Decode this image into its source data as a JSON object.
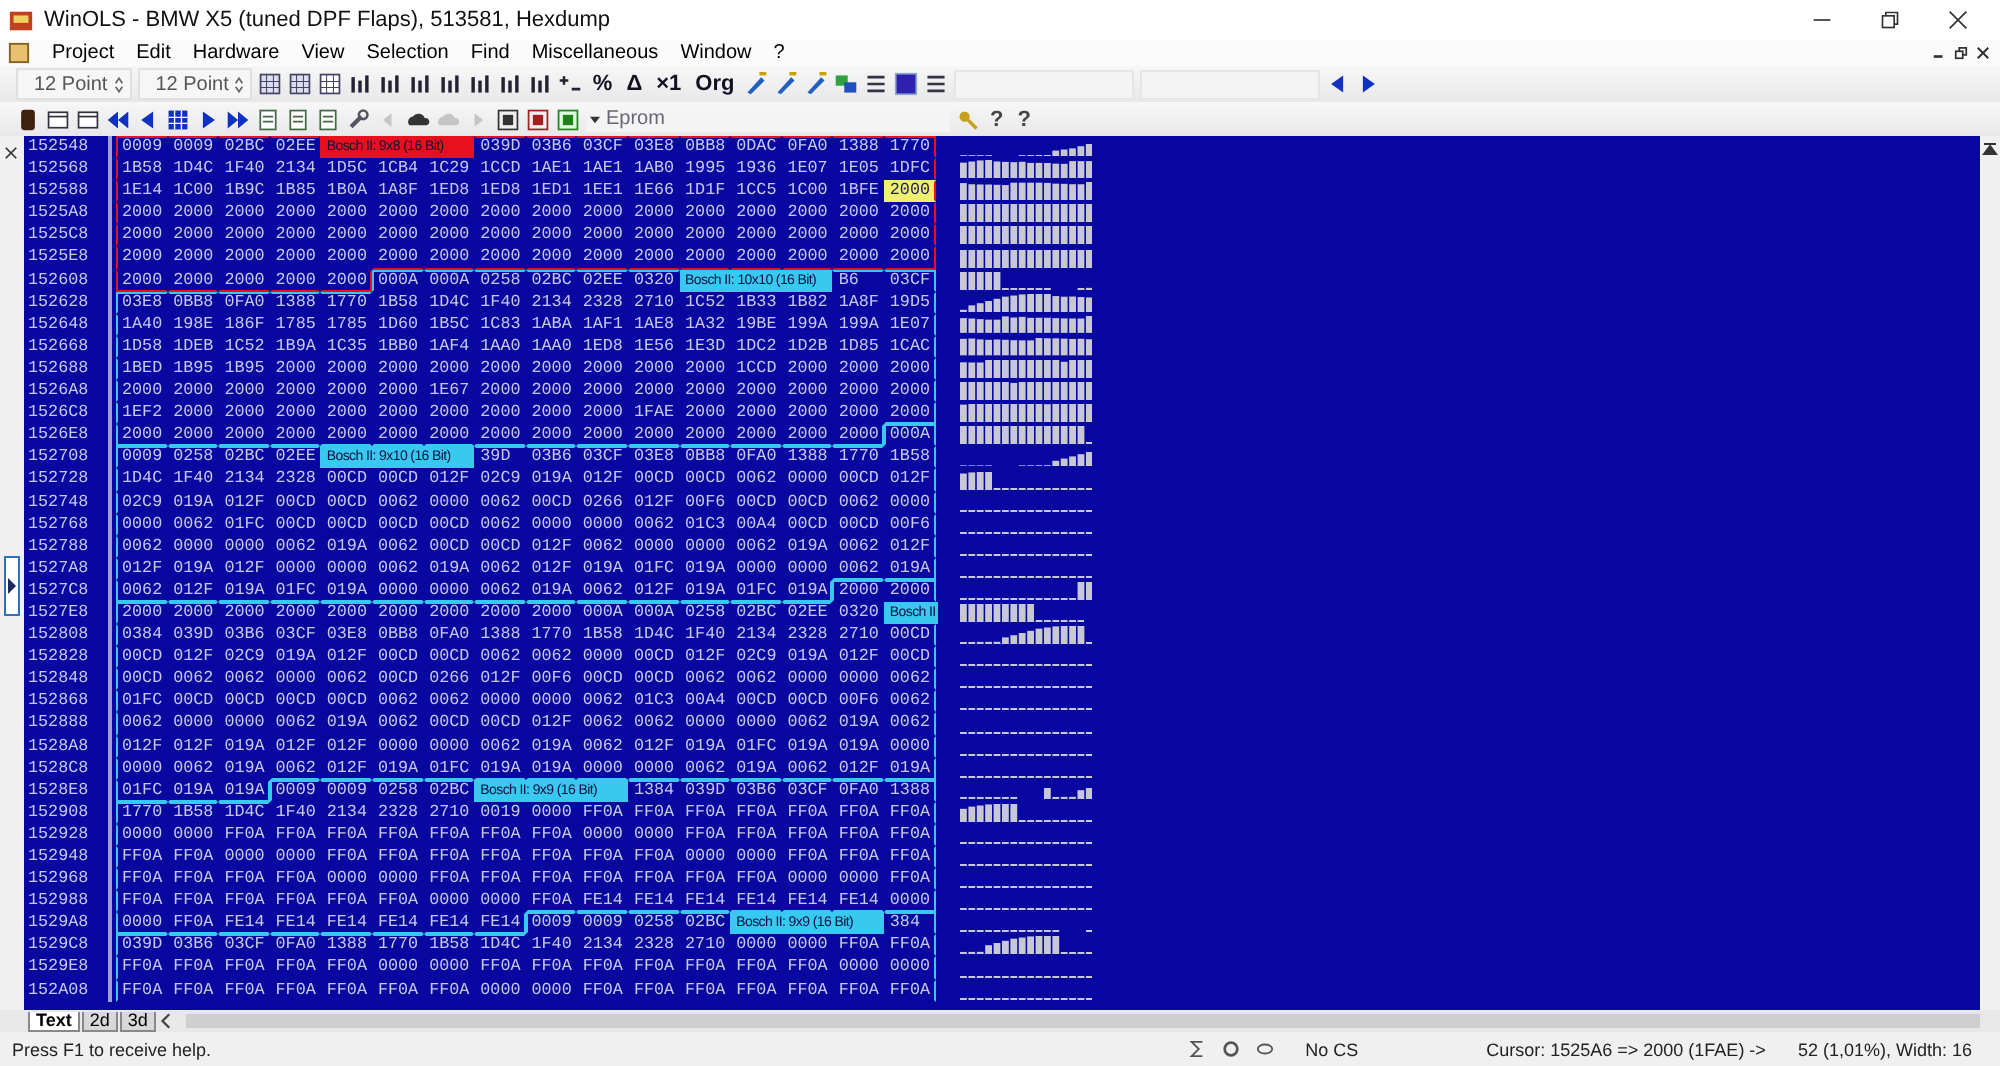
{
  "window": {
    "title": "WinOLS - BMW X5 (tuned DPF Flaps), 513581, Hexdump"
  },
  "menu": [
    "Project",
    "Edit",
    "Hardware",
    "View",
    "Selection",
    "Find",
    "Miscellaneous",
    "Window",
    "?"
  ],
  "toolbar": {
    "font_size_1": "12 Point",
    "font_size_2": "12 Point",
    "glyph_buttons": [
      "%",
      "Δ",
      "×1",
      "Org"
    ],
    "eprom": "Eprom",
    "help_buttons": [
      "?",
      "?"
    ]
  },
  "hexdump": {
    "addresses": [
      "152548",
      "152568",
      "152588",
      "1525A8",
      "1525C8",
      "1525E8",
      "152608",
      "152628",
      "152648",
      "152668",
      "152688",
      "1526A8",
      "1526C8",
      "1526E8",
      "152708",
      "152728",
      "152748",
      "152768",
      "152788",
      "1527A8",
      "1527C8",
      "1527E8",
      "152808",
      "152828",
      "152848",
      "152868",
      "152888",
      "1528A8",
      "1528C8",
      "1528E8",
      "152908",
      "152928",
      "152948",
      "152968",
      "152988",
      "1529A8",
      "1529C8",
      "1529E8",
      "152A08"
    ],
    "blocks": [
      {
        "color": "#e8101c",
        "cells": [
          "0009",
          "0009",
          "02BC",
          "02EE",
          {
            "kind": "label",
            "text": "Bosch II: 9x8 (16 Bit)"
          },
          "039D",
          "03B6",
          "03CF",
          "03E8",
          "0BB8",
          "0DAC",
          "0FA0",
          "1388",
          "1770",
          "1B58",
          "1D4C",
          "1F40",
          "2134",
          "1D5C",
          "1CB4",
          "1C29",
          "1CCD",
          "1AE1",
          "1AE1",
          "1AB0",
          "1995",
          "1936",
          "1E07",
          "1E05",
          "1DFC",
          "1E14",
          "1C00",
          "1B9C",
          "1B85",
          "1B0A",
          "1A8F",
          "1ED8",
          "1ED8",
          "1ED1",
          "1EE1",
          "1E66",
          "1D1F",
          "1CC5",
          "1C00",
          "1BFE",
          {
            "text": "2000",
            "selected": true
          },
          "2000",
          "2000",
          "2000",
          "2000",
          "2000",
          "2000",
          "2000",
          "2000",
          "2000",
          "2000",
          "2000",
          "2000",
          "2000",
          "2000",
          "2000",
          "2000",
          "2000",
          "2000",
          "2000",
          "2000",
          "2000",
          "2000",
          "2000",
          "2000",
          "2000",
          "2000",
          "2000",
          "2000",
          "2000",
          "2000",
          "2000",
          "2000",
          "2000",
          "2000",
          "2000",
          "2000",
          "2000",
          "2000",
          "2000",
          "2000",
          "2000",
          "2000",
          "2000",
          "2000",
          "2000",
          "2000",
          "2000",
          "2000",
          "2000",
          "2000",
          "2000",
          "2000",
          "2000"
        ]
      },
      {
        "color": "#38c8f0",
        "cells": [
          "000A",
          "000A",
          "0258",
          "02BC",
          "02EE",
          "0320",
          {
            "kind": "label",
            "text": "Bosch II: 10x10 (16 Bit)"
          },
          "B6",
          "03CF",
          "03E8",
          "0BB8",
          "0FA0",
          "1388",
          "1770",
          "1B58",
          "1D4C",
          "1F40",
          "2134",
          "2328",
          "2710",
          "1C52",
          "1B33",
          "1B82",
          "1A8F",
          "19D5",
          "1A40",
          "198E",
          "186F",
          "1785",
          "1785",
          "1D60",
          "1B5C",
          "1C83",
          "1ABA",
          "1AF1",
          "1AE8",
          "1A32",
          "19BE",
          "199A",
          "199A",
          "1E07",
          "1D58",
          "1DEB",
          "1C52",
          "1B9A",
          "1C35",
          "1BB0",
          "1AF4",
          "1AA0",
          "1AA0",
          "1ED8",
          "1E56",
          "1E3D",
          "1DC2",
          "1D2B",
          "1D85",
          "1CAC",
          "1BED",
          "1B95",
          "1B95",
          "2000",
          "2000",
          "2000",
          "2000",
          "2000",
          "2000",
          "2000",
          "2000",
          "2000",
          "1CCD",
          "2000",
          "2000",
          "2000",
          "2000",
          "2000",
          "2000",
          "2000",
          "2000",
          "2000",
          "1E67",
          "2000",
          "2000",
          "2000",
          "2000",
          "2000",
          "2000",
          "2000",
          "2000",
          "2000",
          "1EF2",
          "2000",
          "2000",
          "2000",
          "2000",
          "2000",
          "2000",
          "2000",
          "2000",
          "2000",
          "1FAE",
          "2000",
          "2000",
          "2000",
          "2000",
          "2000",
          "2000",
          "2000",
          "2000",
          "2000",
          "2000",
          "2000",
          "2000",
          "2000",
          "2000",
          "2000",
          "2000",
          "2000",
          "2000",
          "2000",
          "2000"
        ]
      },
      {
        "color": "#38c8f0",
        "cells": [
          "000A",
          "0009",
          "0258",
          "02BC",
          "02EE",
          {
            "kind": "label",
            "text": "Bosch II: 9x10 (16 Bit)"
          },
          "39D",
          "03B6",
          "03CF",
          "03E8",
          "0BB8",
          "0FA0",
          "1388",
          "1770",
          "1B58",
          "1D4C",
          "1F40",
          "2134",
          "2328",
          "00CD",
          "00CD",
          "012F",
          "02C9",
          "019A",
          "012F",
          "00CD",
          "00CD",
          "0062",
          "0000",
          "00CD",
          "012F",
          "02C9",
          "019A",
          "012F",
          "00CD",
          "00CD",
          "0062",
          "0000",
          "0062",
          "00CD",
          "0266",
          "012F",
          "00F6",
          "00CD",
          "00CD",
          "0062",
          "0000",
          "0000",
          "0062",
          "01FC",
          "00CD",
          "00CD",
          "00CD",
          "00CD",
          "0062",
          "0000",
          "0000",
          "0062",
          "01C3",
          "00A4",
          "00CD",
          "00CD",
          "00F6",
          "0062",
          "0000",
          "0000",
          "0062",
          "019A",
          "0062",
          "00CD",
          "00CD",
          "012F",
          "0062",
          "0000",
          "0000",
          "0062",
          "019A",
          "0062",
          "012F",
          "012F",
          "019A",
          "012F",
          "0000",
          "0000",
          "0062",
          "019A",
          "0062",
          "012F",
          "019A",
          "01FC",
          "019A",
          "0000",
          "0000",
          "0062",
          "019A",
          "0062",
          "012F",
          "019A",
          "01FC",
          "019A",
          "0000",
          "0000",
          "0062",
          "019A",
          "0062",
          "012F",
          "019A",
          "01FC",
          "019A"
        ]
      },
      {
        "color": "#38c8f0",
        "cells": [
          "2000",
          "2000",
          "2000",
          "2000",
          "2000",
          "2000",
          "2000",
          "2000",
          "2000",
          "2000",
          "2000",
          "000A",
          "000A",
          "0258",
          "02BC",
          "02EE",
          "0320",
          {
            "kind": "label",
            "text": "Bosch II"
          },
          "0384",
          "039D",
          "03B6",
          "03CF",
          "03E8",
          "0BB8",
          "0FA0",
          "1388",
          "1770",
          "1B58",
          "1D4C",
          "1F40",
          "2134",
          "2328",
          "2710",
          "00CD",
          "00CD",
          "012F",
          "02C9",
          "019A",
          "012F",
          "00CD",
          "00CD",
          "0062",
          "0062",
          "0000",
          "00CD",
          "012F",
          "02C9",
          "019A",
          "012F",
          "00CD",
          "00CD",
          "0062",
          "0062",
          "0000",
          "0062",
          "00CD",
          "0266",
          "012F",
          "00F6",
          "00CD",
          "00CD",
          "0062",
          "0062",
          "0000",
          "0000",
          "0062",
          "01FC",
          "00CD",
          "00CD",
          "00CD",
          "00CD",
          "0062",
          "0062",
          "0000",
          "0000",
          "0062",
          "01C3",
          "00A4",
          "00CD",
          "00CD",
          "00F6",
          "0062",
          "0062",
          "0000",
          "0000",
          "0062",
          "019A",
          "0062",
          "00CD",
          "00CD",
          "012F",
          "0062",
          "0062",
          "0000",
          "0000",
          "0062",
          "019A",
          "0062",
          "012F",
          "012F",
          "019A",
          "012F",
          "012F",
          "0000",
          "0000",
          "0062",
          "019A",
          "0062",
          "012F",
          "019A",
          "01FC",
          "019A",
          "019A",
          "0000",
          "0000",
          "0062",
          "019A",
          "0062",
          "012F",
          "019A",
          "01FC",
          "019A",
          "019A",
          "0000",
          "0000",
          "0062",
          "019A",
          "0062",
          "012F",
          "019A",
          "01FC",
          "019A",
          "019A"
        ]
      },
      {
        "color": "#38c8f0",
        "cells": [
          "0009",
          "0009",
          "0258",
          "02BC",
          {
            "kind": "label",
            "text": "Bosch II: 9x9 (16 Bit)"
          },
          "1384",
          "039D",
          "03B6",
          "03CF",
          "0FA0",
          "1388",
          "1770",
          "1B58",
          "1D4C",
          "1F40",
          "2134",
          "2328",
          "2710",
          "0019",
          "0000",
          "FF0A",
          "FF0A",
          "FF0A",
          "FF0A",
          "FF0A",
          "FF0A",
          "FF0A",
          "0000",
          "0000",
          "FF0A",
          "FF0A",
          "FF0A",
          "FF0A",
          "FF0A",
          "FF0A",
          "FF0A",
          "0000",
          "0000",
          "FF0A",
          "FF0A",
          "FF0A",
          "FF0A",
          "FF0A",
          "FF0A",
          "FF0A",
          "0000",
          "0000",
          "FF0A",
          "FF0A",
          "FF0A",
          "FF0A",
          "FF0A",
          "FF0A",
          "FF0A",
          "0000",
          "0000",
          "FF0A",
          "FF0A",
          "FF0A",
          "FF0A",
          "FF0A",
          "FF0A",
          "FF0A",
          "0000",
          "0000",
          "FF0A",
          "FF0A",
          "FF0A",
          "FF0A",
          "FF0A",
          "FF0A",
          "FF0A",
          "0000",
          "0000",
          "FF0A",
          "FF0A",
          "FF0A",
          "FF0A",
          "FF0A",
          "FF0A",
          "FF0A",
          "0000",
          "0000",
          "FF0A",
          "FE14",
          "FE14",
          "FE14",
          "FE14",
          "FE14",
          "FE14",
          "0000",
          "0000",
          "FF0A",
          "FE14",
          "FE14",
          "FE14",
          "FE14",
          "FE14",
          "FE14"
        ]
      },
      {
        "color": "#38c8f0",
        "cells": [
          "0009",
          "0009",
          "0258",
          "02BC",
          {
            "kind": "label",
            "text": "Bosch II: 9x9 (16 Bit)"
          },
          "384",
          "039D",
          "03B6",
          "03CF",
          "0FA0",
          "1388",
          "1770",
          "1B58",
          "1D4C",
          "1F40",
          "2134",
          "2328",
          "2710",
          "0000",
          "0000",
          "FF0A",
          "FF0A",
          "FF0A",
          "FF0A",
          "FF0A",
          "FF0A",
          "FF0A",
          "0000",
          "0000",
          "FF0A",
          "FF0A",
          "FF0A",
          "FF0A",
          "FF0A",
          "FF0A",
          "FF0A",
          "0000",
          "0000",
          "FF0A",
          "FF0A",
          "FF0A",
          "FF0A",
          "FF0A",
          "FF0A",
          "FF0A",
          "0000",
          "0000",
          "FF0A",
          "FF0A",
          "FF0A",
          "FF0A",
          "FF0A",
          "FF0A",
          "FF0A"
        ]
      }
    ]
  },
  "view_tabs": [
    {
      "label": "Text",
      "selected": true
    },
    {
      "label": "2d",
      "selected": false
    },
    {
      "label": "3d",
      "selected": false
    }
  ],
  "status_bar": {
    "help": "Press F1 to receive help.",
    "checksum": "No CS",
    "cursor": "Cursor: 1525A6 => 2000 (1FAE) ->",
    "position": "52 (1,01%), Width: 16"
  }
}
